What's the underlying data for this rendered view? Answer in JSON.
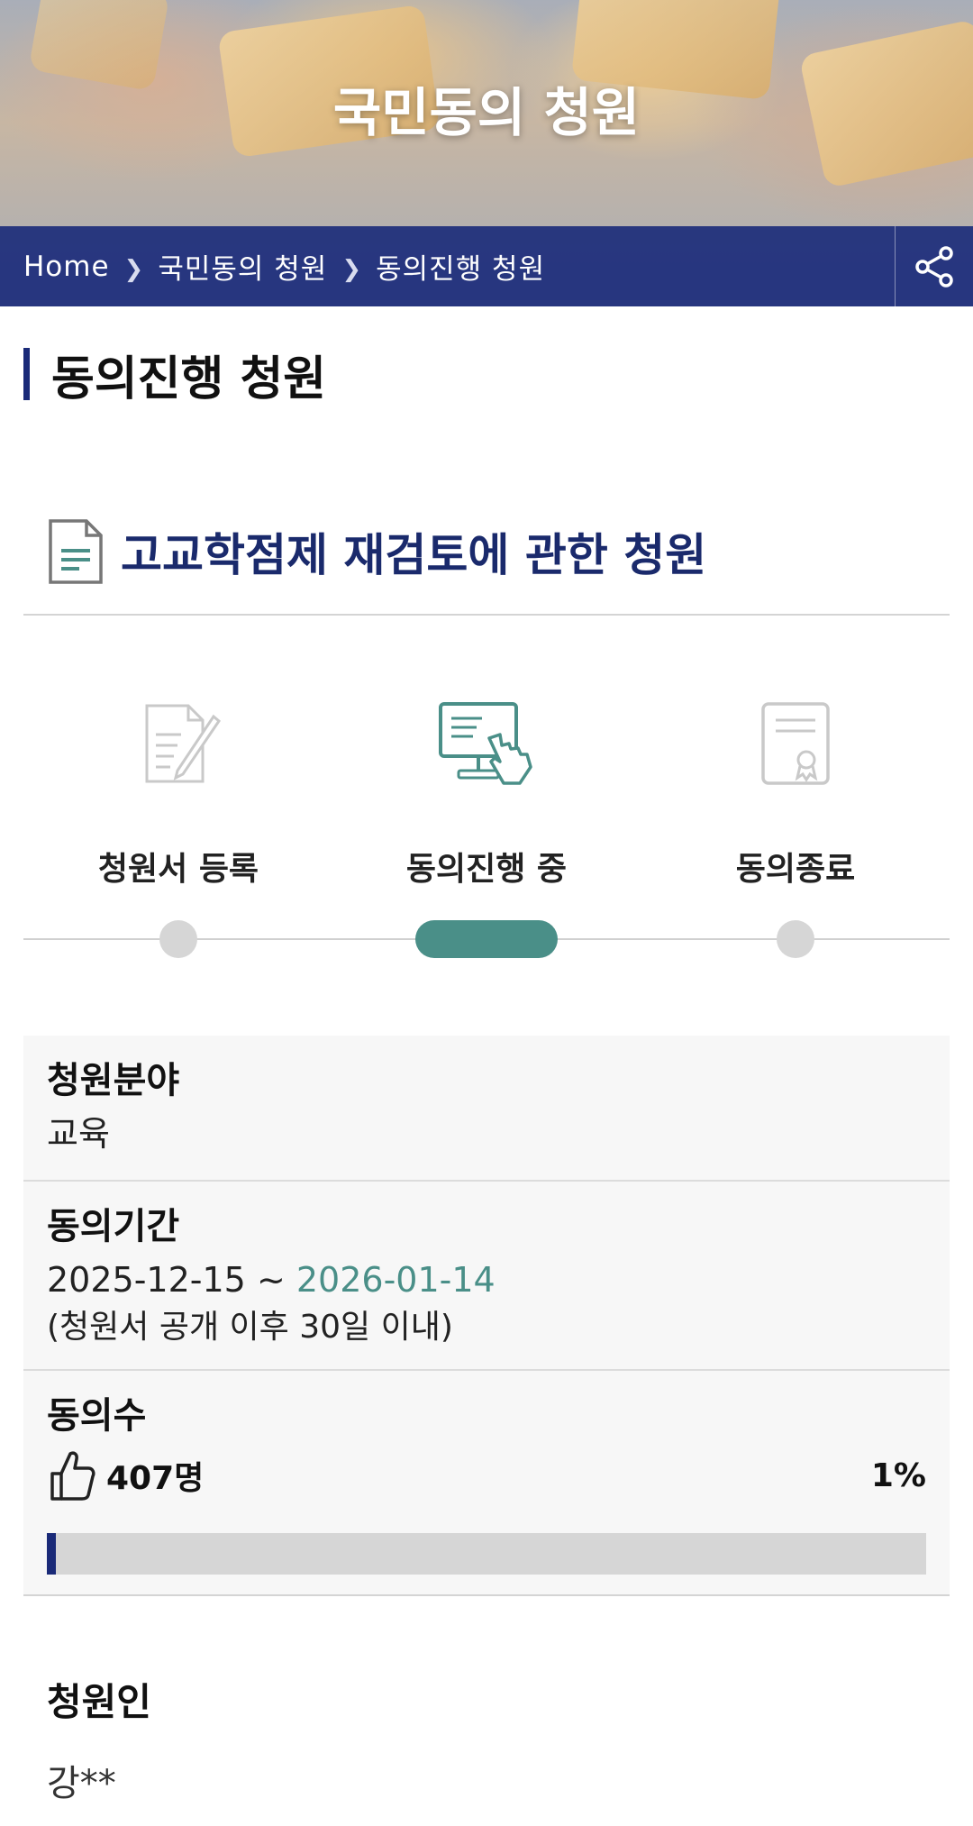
{
  "hero": {
    "title": "국민동의 청원"
  },
  "breadcrumb": {
    "items": [
      "Home",
      "국민동의 청원",
      "동의진행 청원"
    ]
  },
  "page": {
    "heading": "동의진행 청원"
  },
  "petition": {
    "title": "고교학점제 재검토에 관한 청원"
  },
  "steps": [
    {
      "label": "청원서 등록",
      "icon": "document-pen-icon",
      "active": false
    },
    {
      "label": "동의진행 중",
      "icon": "computer-hand-icon",
      "active": true
    },
    {
      "label": "동의종료",
      "icon": "certificate-icon",
      "active": false
    }
  ],
  "info": {
    "field": {
      "label": "청원분야",
      "value": "교육"
    },
    "period": {
      "label": "동의기간",
      "start": "2025-12-15",
      "separator": "~",
      "end": "2026-01-14",
      "note": "(청원서 공개 이후 30일 이내)"
    },
    "agree": {
      "label": "동의수",
      "count": "407명",
      "percent_text": "1%",
      "progress_fraction": 0.01
    }
  },
  "petitioner": {
    "label": "청원인",
    "value": "강**"
  },
  "colors": {
    "navy": "#1a2a78",
    "teal": "#4a8f88",
    "gray": "#d6d6d6"
  }
}
